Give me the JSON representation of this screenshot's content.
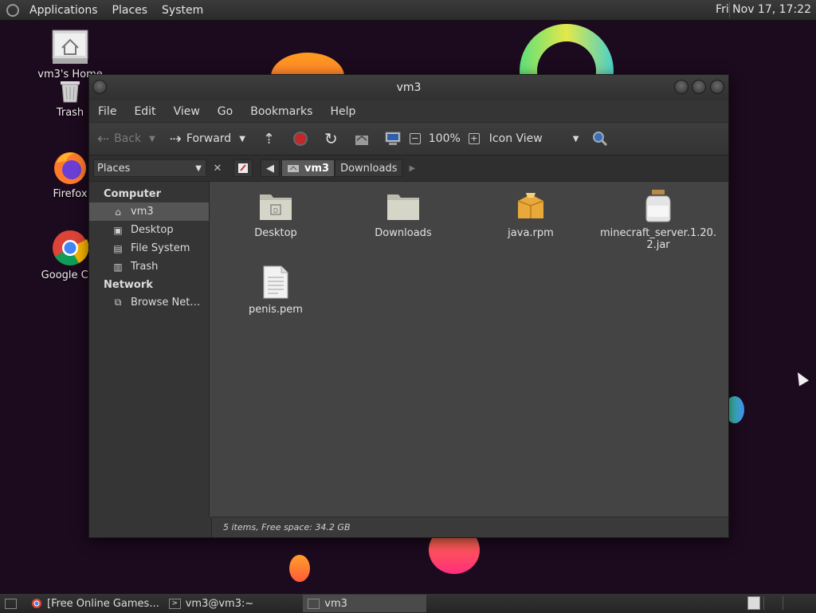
{
  "top_panel": {
    "menu": [
      "Applications",
      "Places",
      "System"
    ],
    "clock": "Fri Nov 17, 17:22"
  },
  "desktop_icons": {
    "home": "vm3's Home",
    "trash": "Trash",
    "firefox": "Firefox",
    "chrome": "Google Chr"
  },
  "window": {
    "title": "vm3",
    "menu": [
      "File",
      "Edit",
      "View",
      "Go",
      "Bookmarks",
      "Help"
    ],
    "toolbar": {
      "back": "Back",
      "forward": "Forward",
      "zoom": "100%",
      "view_mode": "Icon View"
    },
    "places_combo": "Places",
    "breadcrumb": {
      "current": "vm3",
      "next": "Downloads"
    },
    "sidebar": {
      "computer_heading": "Computer",
      "computer_items": [
        "vm3",
        "Desktop",
        "File System",
        "Trash"
      ],
      "network_heading": "Network",
      "network_items": [
        "Browse Net…"
      ]
    },
    "files": [
      {
        "name": "Desktop",
        "kind": "folder-desktop"
      },
      {
        "name": "Downloads",
        "kind": "folder"
      },
      {
        "name": "java.rpm",
        "kind": "package"
      },
      {
        "name": "minecraft_server.1.20.2.jar",
        "name_line1": "minecraft_server.1.20.",
        "name_line2": "2.jar",
        "kind": "jar"
      },
      {
        "name": "penis.pem",
        "kind": "document"
      }
    ],
    "status": "5 items, Free space: 34.2 GB"
  },
  "taskbar": {
    "tasks": [
      "[Free Online Games...",
      "vm3@vm3:~",
      "vm3"
    ]
  },
  "colors": {
    "window_bg": "#353535",
    "file_area_bg": "#444444",
    "selection": "#555555",
    "desktop_bg": "#1c0a1e"
  }
}
